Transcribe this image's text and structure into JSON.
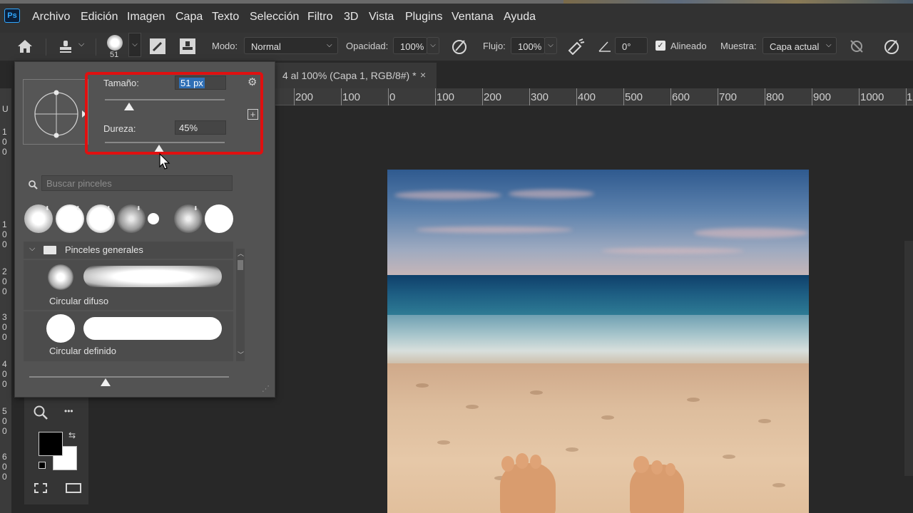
{
  "app": {
    "logo": "Ps"
  },
  "menu": [
    "Archivo",
    "Edición",
    "Imagen",
    "Capa",
    "Texto",
    "Selección",
    "Filtro",
    "3D",
    "Vista",
    "Plugins",
    "Ventana",
    "Ayuda"
  ],
  "options": {
    "brush_size_value": "51",
    "mode_label": "Modo:",
    "mode_value": "Normal",
    "opacity_label": "Opacidad:",
    "opacity_value": "100%",
    "flow_label": "Flujo:",
    "flow_value": "100%",
    "angle_value": "0°",
    "aligned_label": "Alineado",
    "sample_label": "Muestra:",
    "sample_value": "Capa actual"
  },
  "document": {
    "tab_title": "4 al 100% (Capa 1, RGB/8#) *",
    "close_symbol": "×"
  },
  "ruler": {
    "h_labels": [
      "200",
      "100",
      "0",
      "100",
      "200",
      "300",
      "400",
      "500",
      "600",
      "700",
      "800",
      "900",
      "1000",
      "1"
    ],
    "v_labels": [
      "U",
      "1",
      "0",
      "0",
      "1",
      "0",
      "0",
      "2",
      "0",
      "0",
      "3",
      "0",
      "0",
      "4",
      "0",
      "0",
      "5",
      "0",
      "0",
      "6",
      "0",
      "0"
    ]
  },
  "brush_panel": {
    "size_label": "Tamaño:",
    "size_value": "51 px",
    "hardness_label": "Dureza:",
    "hardness_value": "45%",
    "size_fraction": 0.2,
    "hardness_fraction": 0.45,
    "search_placeholder": "Buscar pinceles",
    "folder_label": "Pinceles generales",
    "brushes": [
      "Circular difuso",
      "Circular definido"
    ]
  },
  "toolbar": {
    "more_symbol": "•••"
  },
  "colors": {
    "accent": "#31a8ff",
    "highlight_box": "#e01010",
    "foreground": "#000000",
    "background": "#ffffff"
  }
}
